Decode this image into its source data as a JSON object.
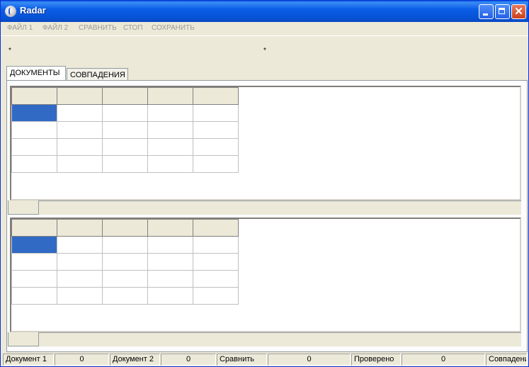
{
  "window": {
    "title": "Radar",
    "controls": {
      "minimize": "minimize",
      "maximize": "maximize",
      "close": "✕"
    }
  },
  "menu": {
    "items": [
      "ФАЙЛ 1",
      "ФАЙЛ 2",
      "СРАВНИТЬ",
      "СТОП",
      "СОХРАНИТЬ"
    ]
  },
  "info": {
    "left_marker": "*",
    "right_marker": "*"
  },
  "tabs": [
    {
      "label": "ДОКУМЕНТЫ",
      "active": true
    },
    {
      "label": "СОВПАДЕНИЯ",
      "active": false
    }
  ],
  "grids": [
    {
      "columns": 5,
      "rows": 4,
      "selected_cell": [
        0,
        0
      ]
    },
    {
      "columns": 5,
      "rows": 4,
      "selected_cell": [
        0,
        0
      ]
    }
  ],
  "status": {
    "doc1_label": "Документ 1",
    "doc1_value": "0",
    "doc2_label": "Документ 2",
    "doc2_value": "0",
    "compare_label": "Сравнить",
    "compare_value": "0",
    "checked_label": "Проверено",
    "checked_value": "0",
    "matches_label": "Совпадения"
  },
  "colors": {
    "selection": "#316ac5",
    "titlebar": "#0a5de0",
    "window_bg": "#ece9d8"
  }
}
